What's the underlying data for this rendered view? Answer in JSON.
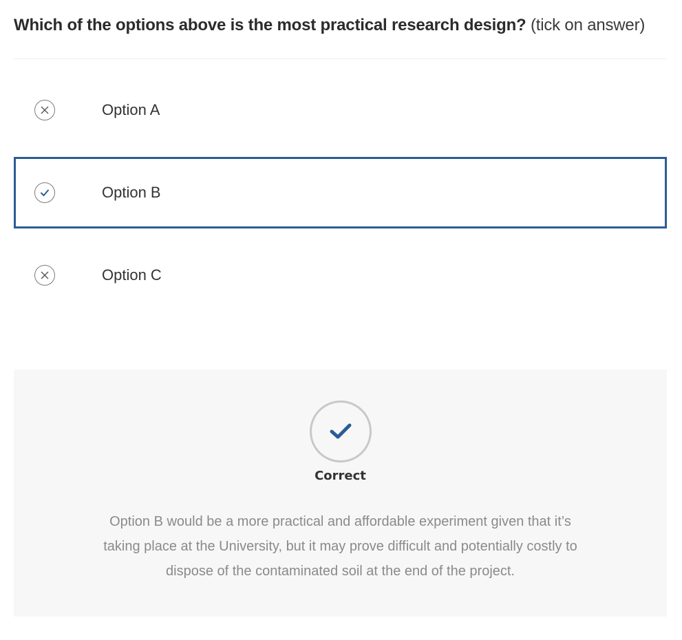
{
  "question": {
    "prompt": "Which of the options above is the most practical research design?",
    "hint": "(tick on answer)"
  },
  "options": [
    {
      "label": "Option A",
      "state": "incorrect",
      "icon": "cross-circle-icon"
    },
    {
      "label": "Option B",
      "state": "selected-correct",
      "icon": "check-circle-icon"
    },
    {
      "label": "Option C",
      "state": "incorrect",
      "icon": "cross-circle-icon"
    }
  ],
  "feedback": {
    "status": "Correct",
    "icon": "check-icon",
    "message": "Option B would be a more practical and affordable experiment given that it’s taking place at the University, but it may prove difficult and potentially costly to dispose of the contaminated soil at the end of the project."
  },
  "colors": {
    "accent": "#2a5c96",
    "feedback_bg": "#f7f7f7",
    "muted_text": "#8a8a8a"
  }
}
